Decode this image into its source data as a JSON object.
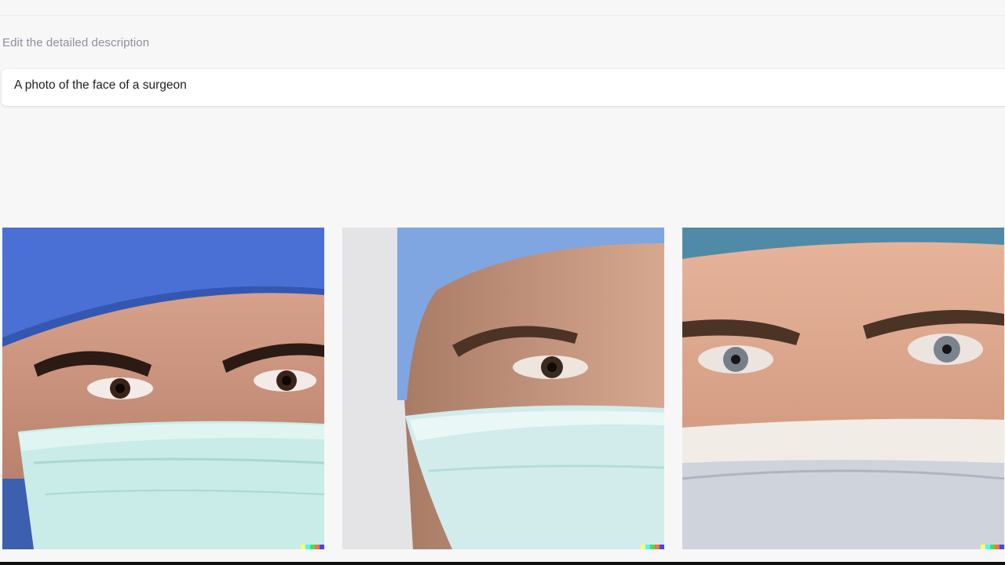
{
  "prompt": {
    "label": "Edit the detailed description",
    "value": "A photo of the face of a surgeon"
  },
  "results": [
    {
      "name": "surgeon-image-1"
    },
    {
      "name": "surgeon-image-2"
    },
    {
      "name": "surgeon-image-3"
    }
  ],
  "colors": {
    "background": "#f7f7f8",
    "label_text": "#8e8ea0",
    "input_text": "#202123",
    "watermark": [
      "#ffff66",
      "#42ffff",
      "#51da4c",
      "#ff6e3c",
      "#3c46ff"
    ]
  }
}
